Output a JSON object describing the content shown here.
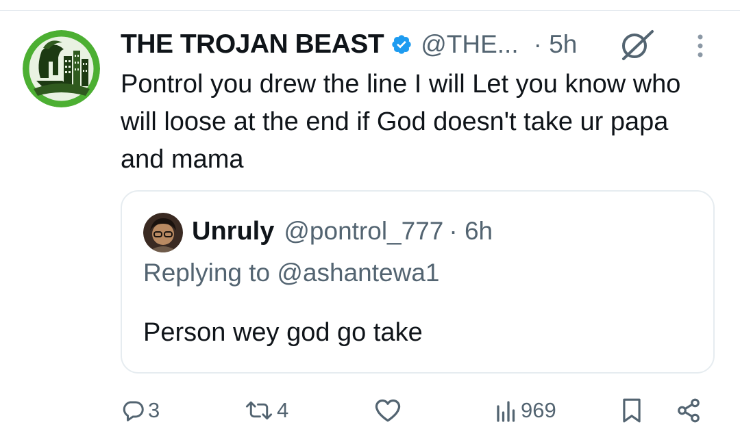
{
  "tweet": {
    "display_name": "THE TROJAN BEAST",
    "handle": "@THE...",
    "time": "· 5h",
    "text": "Pontrol you drew the line I will Let you know who will loose at the end if God doesn't take ur papa and mama",
    "verified": true,
    "icons": {
      "verified": "verified-badge-icon",
      "grok": "grok-icon",
      "more": "more-vertical-icon"
    }
  },
  "quote": {
    "display_name": "Unruly",
    "handle": "@pontrol_777",
    "time": "· 6h",
    "replying_to": "Replying to @ashantewa1",
    "text": "Person wey god go take"
  },
  "actions": {
    "replies": "3",
    "reposts": "4",
    "views": "969",
    "icons": [
      "reply-icon",
      "repost-icon",
      "like-icon",
      "views-icon",
      "bookmark-icon",
      "share-icon"
    ]
  },
  "colors": {
    "text": "#0f1419",
    "secondary": "#536471",
    "verified": "#1d9bf0",
    "border": "#e6ecf0",
    "avatar_green": "#4caf32"
  }
}
